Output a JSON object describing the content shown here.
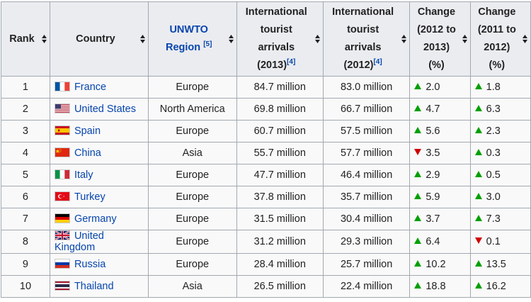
{
  "headers": {
    "rank": "Rank",
    "country": "Country",
    "region": {
      "text": "UNWTO Region",
      "ref": "[5]"
    },
    "arrivals_2013": {
      "l1": "International",
      "l2": "tourist",
      "l3": "arrivals",
      "l4": "(2013)",
      "ref": "[4]"
    },
    "arrivals_2012": {
      "l1": "International",
      "l2": "tourist",
      "l3": "arrivals",
      "l4": "(2012)",
      "ref": "[4]"
    },
    "change_1": {
      "l1": "Change",
      "l2": "(2012 to",
      "l3": "2013)",
      "l4": "(%)"
    },
    "change_2": {
      "l1": "Change",
      "l2": "(2011 to",
      "l3": "2012)",
      "l4": "(%)"
    }
  },
  "rows": [
    {
      "rank": "1",
      "country": "France",
      "flag": "france-flag-icon",
      "region": "Europe",
      "a2013": "84.7 million",
      "a2012": "83.0 million",
      "c1": "2.0",
      "c1dir": "up",
      "c2": "1.8",
      "c2dir": "up"
    },
    {
      "rank": "2",
      "country": "United States",
      "flag": "usa-flag-icon",
      "region": "North America",
      "a2013": "69.8 million",
      "a2012": "66.7 million",
      "c1": "4.7",
      "c1dir": "up",
      "c2": "6.3",
      "c2dir": "up"
    },
    {
      "rank": "3",
      "country": "Spain",
      "flag": "spain-flag-icon",
      "region": "Europe",
      "a2013": "60.7 million",
      "a2012": "57.5 million",
      "c1": "5.6",
      "c1dir": "up",
      "c2": "2.3",
      "c2dir": "up"
    },
    {
      "rank": "4",
      "country": "China",
      "flag": "china-flag-icon",
      "region": "Asia",
      "a2013": "55.7 million",
      "a2012": "57.7 million",
      "c1": "3.5",
      "c1dir": "down",
      "c2": "0.3",
      "c2dir": "up"
    },
    {
      "rank": "5",
      "country": "Italy",
      "flag": "italy-flag-icon",
      "region": "Europe",
      "a2013": "47.7 million",
      "a2012": "46.4 million",
      "c1": "2.9",
      "c1dir": "up",
      "c2": "0.5",
      "c2dir": "up"
    },
    {
      "rank": "6",
      "country": "Turkey",
      "flag": "turkey-flag-icon",
      "region": "Europe",
      "a2013": "37.8 million",
      "a2012": "35.7 million",
      "c1": "5.9",
      "c1dir": "up",
      "c2": "3.0",
      "c2dir": "up"
    },
    {
      "rank": "7",
      "country": "Germany",
      "flag": "germany-flag-icon",
      "region": "Europe",
      "a2013": "31.5 million",
      "a2012": "30.4 million",
      "c1": "3.7",
      "c1dir": "up",
      "c2": "7.3",
      "c2dir": "up"
    },
    {
      "rank": "8",
      "country": "United Kingdom",
      "flag": "uk-flag-icon",
      "region": "Europe",
      "a2013": "31.2 million",
      "a2012": "29.3 million",
      "c1": "6.4",
      "c1dir": "up",
      "c2": "0.1",
      "c2dir": "down"
    },
    {
      "rank": "9",
      "country": "Russia",
      "flag": "russia-flag-icon",
      "region": "Europe",
      "a2013": "28.4 million",
      "a2012": "25.7 million",
      "c1": "10.2",
      "c1dir": "up",
      "c2": "13.5",
      "c2dir": "up"
    },
    {
      "rank": "10",
      "country": "Thailand",
      "flag": "thailand-flag-icon",
      "region": "Asia",
      "a2013": "26.5 million",
      "a2012": "22.4 million",
      "c1": "18.8",
      "c1dir": "up",
      "c2": "16.2",
      "c2dir": "up"
    }
  ],
  "colors": {
    "link": "#0645ad",
    "increase": "#00a000",
    "decrease": "#d00000",
    "header_bg": "#eaecf0",
    "border": "#a2a9b1"
  }
}
